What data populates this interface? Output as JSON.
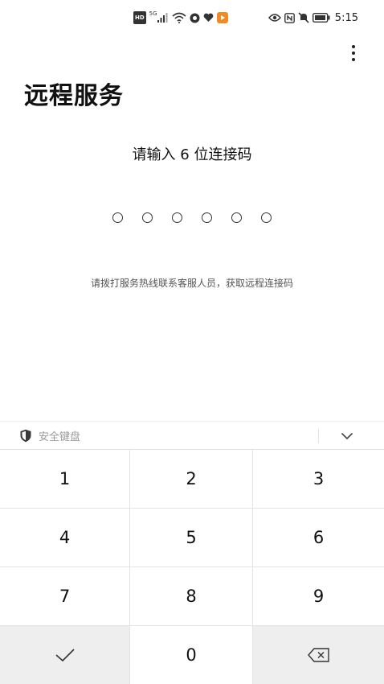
{
  "status_bar": {
    "hd": "HD",
    "network": "5G",
    "time": "5:15",
    "left_icons": [
      "hd-icon",
      "signal-icon",
      "wifi-icon",
      "app-icon",
      "heart-icon",
      "notification-icon"
    ],
    "right_icons": [
      "eye-icon",
      "nfc-icon",
      "mute-icon",
      "battery-icon"
    ]
  },
  "header": {
    "title": "远程服务",
    "menu_icon": "more-vertical-icon"
  },
  "main": {
    "prompt": "请输入 6 位连接码",
    "code_length": 6,
    "hint": "请拨打服务热线联系客服人员，获取远程连接码"
  },
  "keyboard": {
    "label": "安全键盘",
    "shield_icon": "shield-icon",
    "collapse_icon": "chevron-down-icon",
    "keys": [
      "1",
      "2",
      "3",
      "4",
      "5",
      "6",
      "7",
      "8",
      "9"
    ],
    "zero": "0",
    "confirm_icon": "check-icon",
    "delete_icon": "backspace-icon"
  }
}
